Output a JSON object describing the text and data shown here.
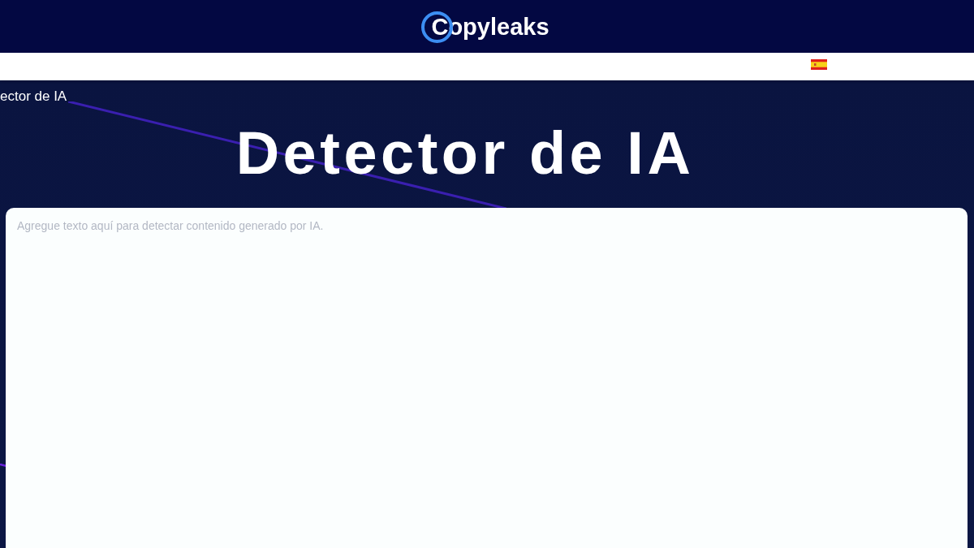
{
  "header": {
    "logo": "Copyleaks"
  },
  "breadcrumb": "ector de IA",
  "title": "Detector de IA",
  "text_input": {
    "placeholder": "Agregue texto aquí para detectar contenido generado por IA."
  }
}
